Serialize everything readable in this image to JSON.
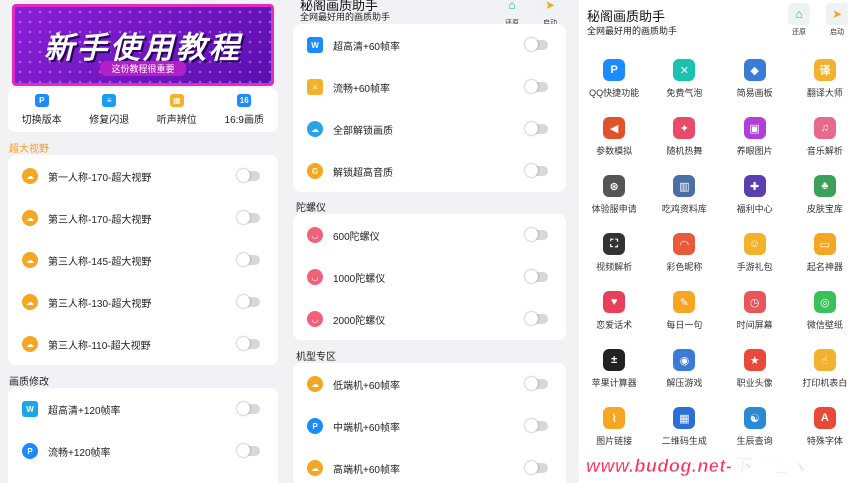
{
  "panel1": {
    "banner": {
      "title": "新手使用教程",
      "subtitle": "这份教程很重要"
    },
    "quick": [
      {
        "label": "切换版本",
        "icon": "p-icon",
        "color": "#1a8cff",
        "glyph": "P"
      },
      {
        "label": "修复闪退",
        "icon": "stack-icon",
        "color": "#1a9cf0",
        "glyph": "≡"
      },
      {
        "label": "听声辨位",
        "icon": "grid-icon",
        "color": "#f2b22e",
        "glyph": "▦"
      },
      {
        "label": "16:9画质",
        "icon": "aspect-icon",
        "color": "#1a8cff",
        "glyph": "16"
      }
    ],
    "section1": "超大视野",
    "views": [
      "第一人称-170-超大视野",
      "第三人称-170-超大视野",
      "第三人称-145-超大视野",
      "第三人称-130-超大视野",
      "第三人称-110-超大视野"
    ],
    "section2": "画质修改",
    "quality": [
      {
        "label": "超高清+120帧率",
        "color": "#1aa6e8",
        "glyph": "W"
      },
      {
        "label": "流畅+120帧率",
        "color": "#1a8cff",
        "glyph": "P"
      }
    ]
  },
  "panel2": {
    "app_title": "秘阁画质助手",
    "app_sub": "全网最好用的画质助手",
    "restore": "还原",
    "launch": "启动",
    "quality": [
      {
        "label": "超高清+60帧率",
        "color": "#1a8cff",
        "glyph": "W"
      },
      {
        "label": "流畅+60帧率",
        "color": "#f2b22e",
        "glyph": "≡"
      },
      {
        "label": "全部解锁画质",
        "color": "#2aa2e8",
        "glyph": "☁"
      },
      {
        "label": "解锁超高音质",
        "color": "#f5a623",
        "glyph": "G"
      }
    ],
    "section_gyro": "陀螺仪",
    "gyro": [
      {
        "label": "600陀螺仪",
        "color": "#f2617a",
        "glyph": "◡"
      },
      {
        "label": "1000陀螺仪",
        "color": "#f2617a",
        "glyph": "◡"
      },
      {
        "label": "2000陀螺仪",
        "color": "#f2617a",
        "glyph": "◡"
      }
    ],
    "section_model": "机型专区",
    "models": [
      {
        "label": "低端机+60帧率",
        "color": "#f5a623",
        "glyph": "☁"
      },
      {
        "label": "中端机+60帧率",
        "color": "#1a8cff",
        "glyph": "P"
      },
      {
        "label": "高端机+60帧率",
        "color": "#f5a623",
        "glyph": "☁"
      }
    ]
  },
  "panel3": {
    "app_title": "秘阁画质助手",
    "app_sub": "全网最好用的画质助手",
    "restore": "还原",
    "launch": "启动",
    "tools": [
      {
        "label": "QQ快捷功能",
        "icon": "p-icon",
        "color": "#1a8cff",
        "glyph": "P"
      },
      {
        "label": "免费气泡",
        "icon": "bubble-icon",
        "color": "#19c3b0",
        "glyph": "✕"
      },
      {
        "label": "简易画板",
        "icon": "palette-icon",
        "color": "#3a7bd5",
        "glyph": "◆"
      },
      {
        "label": "翻译大师",
        "icon": "translate-icon",
        "color": "#f2b22e",
        "glyph": "译"
      },
      {
        "label": "参数模拟",
        "icon": "megaphone-icon",
        "color": "#e0532a",
        "glyph": "◀"
      },
      {
        "label": "随机热舞",
        "icon": "dance-icon",
        "color": "#e84a6a",
        "glyph": "✦"
      },
      {
        "label": "养眼图片",
        "icon": "bag-icon",
        "color": "#b13ed6",
        "glyph": "▣"
      },
      {
        "label": "音乐解析",
        "icon": "music-icon",
        "color": "#e86a8a",
        "glyph": "♫"
      },
      {
        "label": "体验服申请",
        "icon": "stamp-icon",
        "color": "#555555",
        "glyph": "⊛"
      },
      {
        "label": "吃鸡资料库",
        "icon": "library-icon",
        "color": "#4a6fa5",
        "glyph": "▥"
      },
      {
        "label": "福利中心",
        "icon": "gift-icon",
        "color": "#5a3fb0",
        "glyph": "✚"
      },
      {
        "label": "皮肤宝库",
        "icon": "coat-icon",
        "color": "#3aa05a",
        "glyph": "♣"
      },
      {
        "label": "视频解析",
        "icon": "video-icon",
        "color": "#333333",
        "glyph": "⛶"
      },
      {
        "label": "彩色昵称",
        "icon": "rainbow-icon",
        "color": "#e85a3a",
        "glyph": "◠"
      },
      {
        "label": "手游礼包",
        "icon": "penguin-icon",
        "color": "#f2b22e",
        "glyph": "☺"
      },
      {
        "label": "起名神器",
        "icon": "card-icon",
        "color": "#f5a623",
        "glyph": "▭"
      },
      {
        "label": "恋爱话术",
        "icon": "heart-icon",
        "color": "#e8405a",
        "glyph": "♥"
      },
      {
        "label": "每日一句",
        "icon": "note-icon",
        "color": "#f5a623",
        "glyph": "✎"
      },
      {
        "label": "时间屏幕",
        "icon": "clock-icon",
        "color": "#e8565a",
        "glyph": "◷"
      },
      {
        "label": "微信壁纸",
        "icon": "wechat-icon",
        "color": "#3ac15a",
        "glyph": "◎"
      },
      {
        "label": "苹果计算器",
        "icon": "calculator-icon",
        "color": "#222222",
        "glyph": "±"
      },
      {
        "label": "解压游戏",
        "icon": "game-icon",
        "color": "#3a7bd5",
        "glyph": "◉"
      },
      {
        "label": "职业头像",
        "icon": "medal-icon",
        "color": "#e84a3a",
        "glyph": "★"
      },
      {
        "label": "打印机表白",
        "icon": "hand-icon",
        "color": "#f2b22e",
        "glyph": "☝"
      },
      {
        "label": "图片链接",
        "icon": "clip-icon",
        "color": "#f5a623",
        "glyph": "⌇"
      },
      {
        "label": "二维码生成",
        "icon": "qr-icon",
        "color": "#2a6fd5",
        "glyph": "▦"
      },
      {
        "label": "生辰查询",
        "icon": "taiji-icon",
        "color": "#2a8ad5",
        "glyph": "☯"
      },
      {
        "label": "特殊字体",
        "icon": "font-icon",
        "color": "#e84a3a",
        "glyph": "A"
      }
    ]
  },
  "watermark": "www.budog.net-不懂社区"
}
